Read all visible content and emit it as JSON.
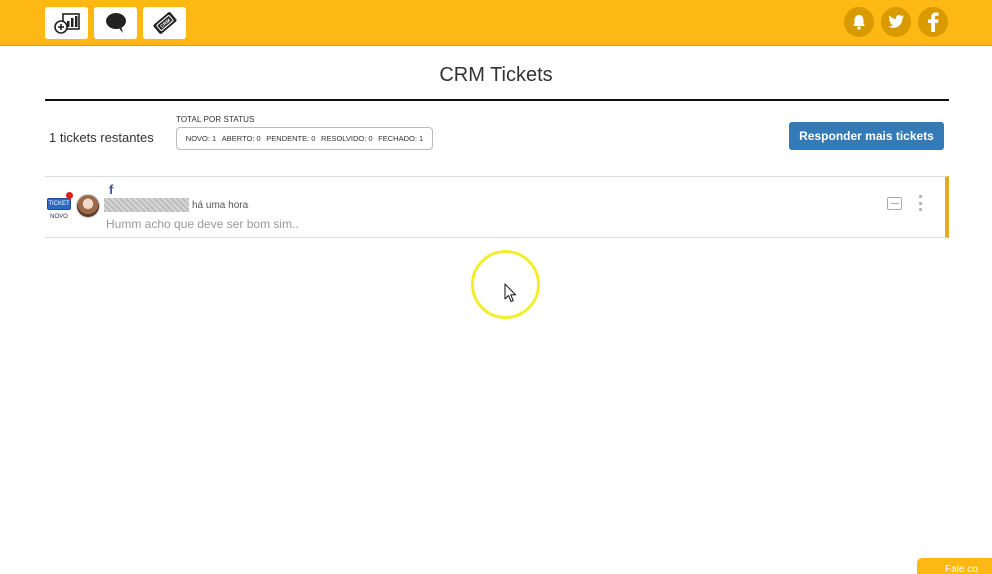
{
  "header": {
    "buttons": [
      {
        "icon": "dashboard-add-icon"
      },
      {
        "icon": "chat-bubble-icon"
      },
      {
        "icon": "crm-ticket-icon"
      }
    ],
    "right_icons": [
      "bell-icon",
      "twitter-icon",
      "facebook-icon"
    ],
    "colors": {
      "bar": "#fdb813",
      "button_bg": "#ffffff",
      "round_button": "#d99a00"
    }
  },
  "page": {
    "title": "CRM Tickets"
  },
  "summary": {
    "remaining": "1 tickets restantes",
    "status_title": "TOTAL POR STATUS",
    "statuses": [
      {
        "label": "NOVO: 1"
      },
      {
        "label": "ABERTO: 0"
      },
      {
        "label": "PENDENTE: 0"
      },
      {
        "label": "RESOLVIDO: 0"
      },
      {
        "label": "FECHADO: 1"
      }
    ],
    "reply_button": "Responder mais tickets",
    "reply_color": "#337ab7"
  },
  "tickets": [
    {
      "badge": "TICKET",
      "status": "NOVO",
      "channel_mark": "f",
      "time": "há uma hora",
      "message": "Humm acho que deve ser bom sim..",
      "accent": "#e8a823"
    }
  ],
  "chat_tab": {
    "label": "Fale co"
  }
}
